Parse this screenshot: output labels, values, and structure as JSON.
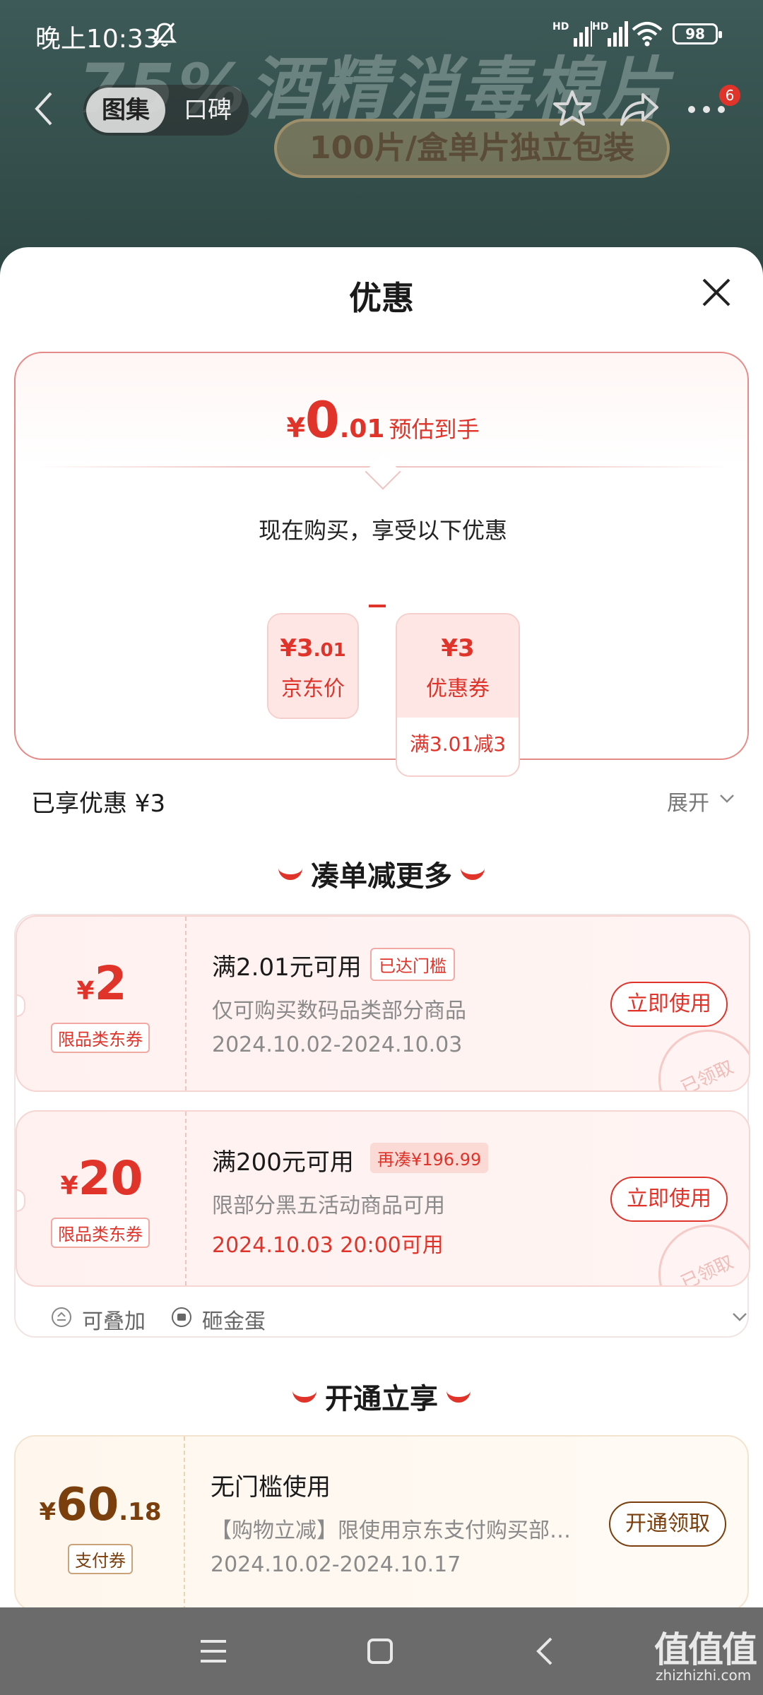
{
  "status_bar": {
    "time": "晚上10:33",
    "signal_label": "HD",
    "battery": "98"
  },
  "banner": {
    "title": "75%酒精消毒棉片",
    "subtitle": "100片/盒单片独立包装"
  },
  "nav": {
    "tabs": [
      "图集",
      "口碑"
    ],
    "more_badge": "6"
  },
  "sheet": {
    "title": "优惠"
  },
  "price_card": {
    "currency": "¥",
    "price_int": "0",
    "price_dec": ".01",
    "price_note": "预估到手",
    "subtitle": "现在购买，享受以下优惠",
    "jd_price": {
      "int": "3",
      "dec": ".01",
      "label": "京东价"
    },
    "coupon": {
      "amount": "3",
      "label": "优惠券",
      "condition": "满3.01减3"
    }
  },
  "enjoyed": {
    "text": "已享优惠 ¥3",
    "expand": "展开"
  },
  "section_more": {
    "title": "凑单减更多"
  },
  "coupons": [
    {
      "amount": "2",
      "tag": "限品类东券",
      "condition": "满2.01元可用",
      "badge": "已达门槛",
      "desc": "仅可购买数码品类部分商品",
      "date": "2024.10.02-2024.10.03",
      "button": "立即使用",
      "stamp": "已领取"
    },
    {
      "amount": "20",
      "tag": "限品类东券",
      "condition": "满200元可用",
      "badge": "再凑¥196.99",
      "desc": "限部分黑五活动商品可用",
      "date": "2024.10.03 20:00可用",
      "button": "立即使用",
      "stamp": "已领取"
    }
  ],
  "coupon_footer": {
    "stackable": "可叠加",
    "golden_egg": "砸金蛋"
  },
  "section_open": {
    "title": "开通立享"
  },
  "pay_coupon": {
    "amount_int": "60",
    "amount_dec": ".18",
    "tag": "支付券",
    "condition": "无门槛使用",
    "desc": "【购物立减】限使用京东支付购买部…",
    "date": "2024.10.02-2024.10.17",
    "button": "开通领取"
  },
  "watermark": {
    "main": "值值值",
    "sub": "zhizhizhi.com"
  },
  "colors": {
    "accent": "#e0342b",
    "gold": "#7a3f0c"
  }
}
